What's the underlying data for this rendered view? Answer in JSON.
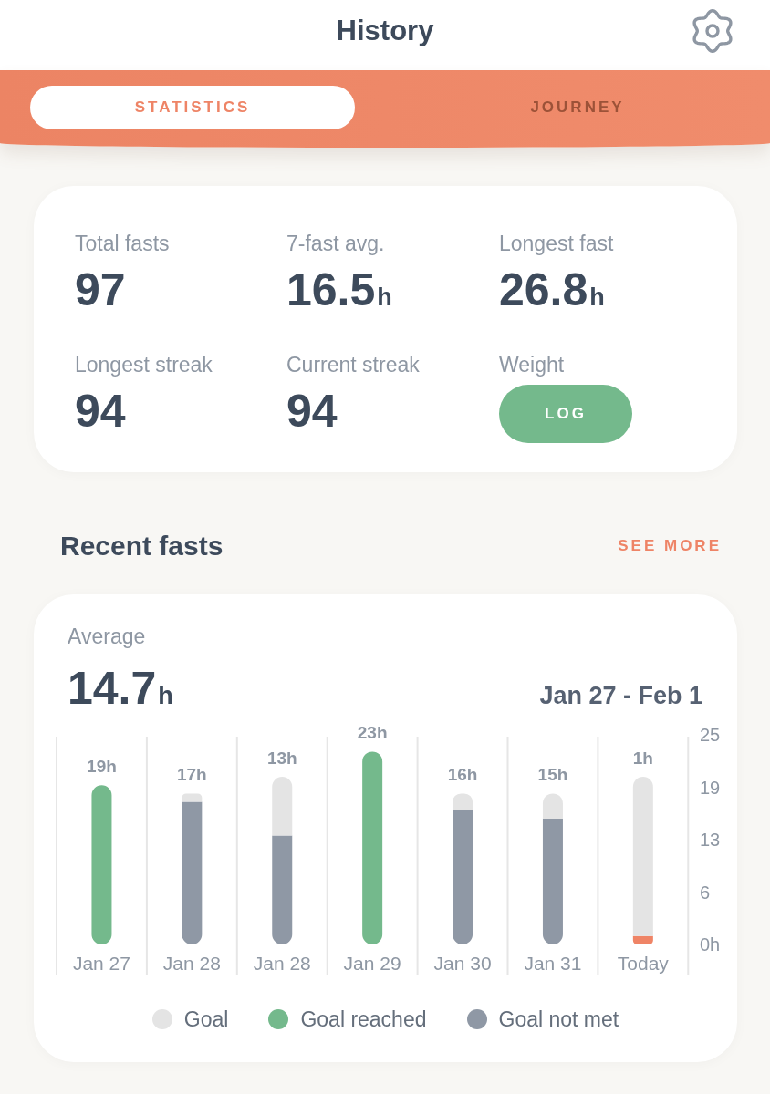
{
  "header": {
    "title": "History"
  },
  "tabs": [
    {
      "label": "STATISTICS",
      "selected": true
    },
    {
      "label": "JOURNEY",
      "selected": false
    }
  ],
  "stats": [
    {
      "kind": "number",
      "label": "Total fasts",
      "value": "97"
    },
    {
      "kind": "number",
      "label": "7-fast avg.",
      "value": "16.5",
      "unit": "h"
    },
    {
      "kind": "number",
      "label": "Longest fast",
      "value": "26.8",
      "unit": "h"
    },
    {
      "kind": "number",
      "label": "Longest streak",
      "value": "94"
    },
    {
      "kind": "number",
      "label": "Current streak",
      "value": "94"
    },
    {
      "kind": "button",
      "label": "Weight",
      "button": "LOG"
    }
  ],
  "recent": {
    "title": "Recent fasts",
    "link": "SEE MORE",
    "average_label": "Average",
    "average_value": "14.7",
    "average_unit": "h",
    "date_range": "Jan 27 - Feb 1",
    "chart_data": {
      "type": "bar",
      "categories": [
        "Jan 27",
        "Jan 28",
        "Jan 28",
        "Jan 29",
        "Jan 30",
        "Jan 31",
        "Today"
      ],
      "ylim": [
        0,
        25
      ],
      "yticks": [
        {
          "value": 0,
          "label": "0h"
        },
        {
          "value": 6.25,
          "label": "6"
        },
        {
          "value": 12.5,
          "label": "13"
        },
        {
          "value": 18.75,
          "label": "19"
        },
        {
          "value": 25,
          "label": "25"
        }
      ],
      "stacked": true,
      "value_labels": [
        "19h",
        "17h",
        "13h",
        "23h",
        "16h",
        "15h",
        "1h"
      ],
      "series": [
        {
          "name": "Goal not met",
          "color": "#8f98a5",
          "values": [
            null,
            17,
            13,
            null,
            16,
            15,
            null
          ]
        },
        {
          "name": "Goal reached",
          "color": "#74b98c",
          "values": [
            19,
            null,
            null,
            23,
            null,
            null,
            null
          ]
        },
        {
          "color": "#ef8466",
          "values": [
            null,
            null,
            null,
            null,
            null,
            null,
            1
          ]
        },
        {
          "name": "Goal",
          "color": "#e4e4e4",
          "values": [
            null,
            1,
            7,
            null,
            2,
            3,
            19
          ]
        }
      ]
    }
  }
}
